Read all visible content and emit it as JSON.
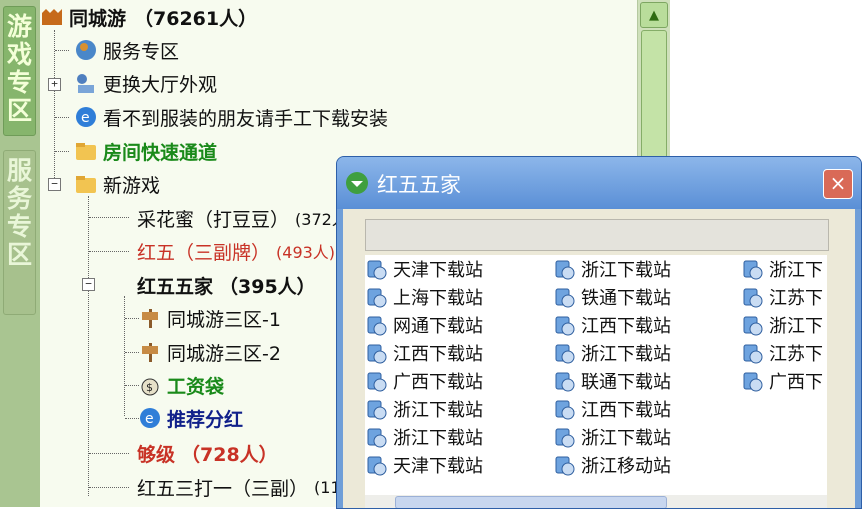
{
  "side_tabs": {
    "games": [
      "游",
      "戏",
      "专",
      "区"
    ],
    "service": [
      "服",
      "务",
      "专",
      "区"
    ]
  },
  "tree": {
    "root": {
      "name": "同城游",
      "count": "（76261人）"
    },
    "items": [
      {
        "label": "服务专区"
      },
      {
        "label": "更换大厅外观"
      },
      {
        "label": "看不到服装的朋友请手工下载安装"
      },
      {
        "label": "房间快速通道"
      },
      {
        "label": "新游戏"
      },
      {
        "label": "采花蜜（打豆豆）",
        "count": "(372人"
      },
      {
        "label": "红五（三副牌）",
        "count": "(493人)"
      },
      {
        "label": "红五五家",
        "count": "（395人）"
      },
      {
        "label": "同城游三区-1"
      },
      {
        "label": "同城游三区-2"
      },
      {
        "label": "工资袋"
      },
      {
        "label": "推荐分红"
      },
      {
        "label": "够级",
        "count": "（728人）"
      },
      {
        "label": "红五三打一（三副）",
        "count": "(11"
      }
    ],
    "colors": {
      "highlight_green": "#1a8a1a",
      "highlight_red": "#c83226",
      "highlight_blue": "#10208a"
    }
  },
  "dialog": {
    "title": "红五五家",
    "close_label": "×",
    "servers": [
      [
        "天津下载站",
        "上海下载站",
        "网通下载站",
        "江西下载站",
        "广西下载站",
        "浙江下载站",
        "浙江下载站",
        "天津下载站"
      ],
      [
        "浙江下载站",
        "铁通下载站",
        "江西下载站",
        "浙江下载站",
        "联通下载站",
        "江西下载站",
        "浙江下载站",
        "浙江移动站"
      ],
      [
        "浙江下",
        "江苏下",
        "浙江下",
        "江苏下",
        "广西下"
      ]
    ]
  }
}
